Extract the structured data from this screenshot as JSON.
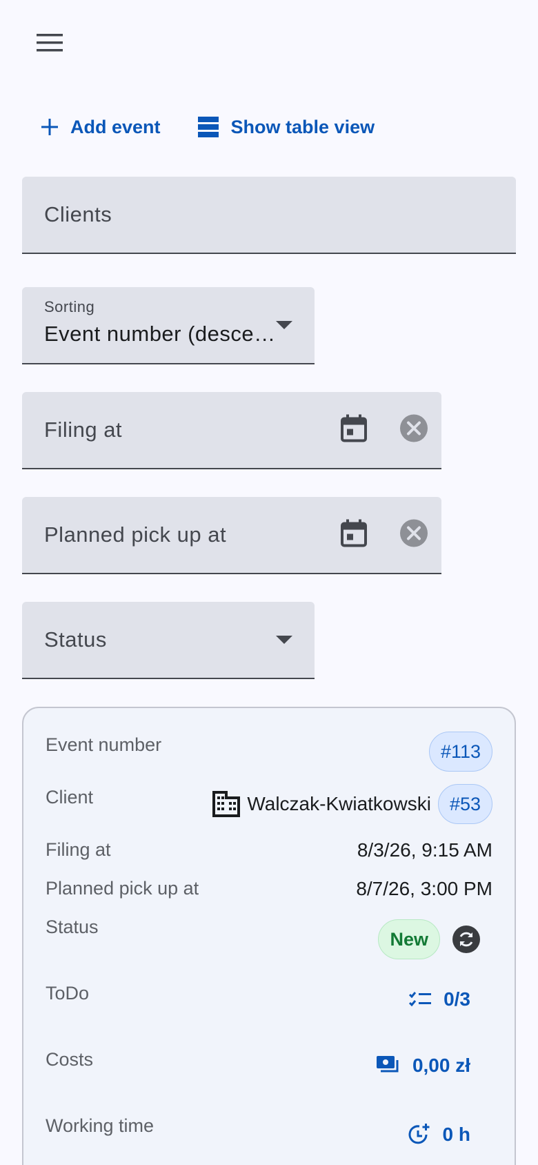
{
  "toolbar": {
    "add_event_label": "Add event",
    "table_view_label": "Show table view"
  },
  "filters": {
    "clients_label": "Clients",
    "sorting_label": "Sorting",
    "sorting_value": "Event number (descending)",
    "filing_label": "Filing at",
    "pickup_label": "Planned pick up at",
    "status_label": "Status"
  },
  "card": {
    "event_number_label": "Event number",
    "event_number": "#113",
    "client_label": "Client",
    "client_name": "Walczak-Kwiatkowski",
    "client_id": "#53",
    "filing_label": "Filing at",
    "filing_value": "8/3/26, 9:15 AM",
    "pickup_label": "Planned pick up at",
    "pickup_value": "8/7/26, 3:00 PM",
    "status_label": "Status",
    "status_value": "New",
    "todo_label": "ToDo",
    "todo_value": "0/3",
    "costs_label": "Costs",
    "costs_value": "0,00 zł",
    "working_time_label": "Working time",
    "working_time_value": "0 h"
  },
  "colors": {
    "accent": "#0b57b8",
    "status_new": "#137a35",
    "field_bg": "#e0e2ea"
  },
  "icons": [
    "menu-icon",
    "plus-icon",
    "table-view-icon",
    "calendar-icon",
    "clear-icon",
    "building-icon",
    "refresh-icon",
    "checklist-icon",
    "payments-icon",
    "clock-icon"
  ]
}
